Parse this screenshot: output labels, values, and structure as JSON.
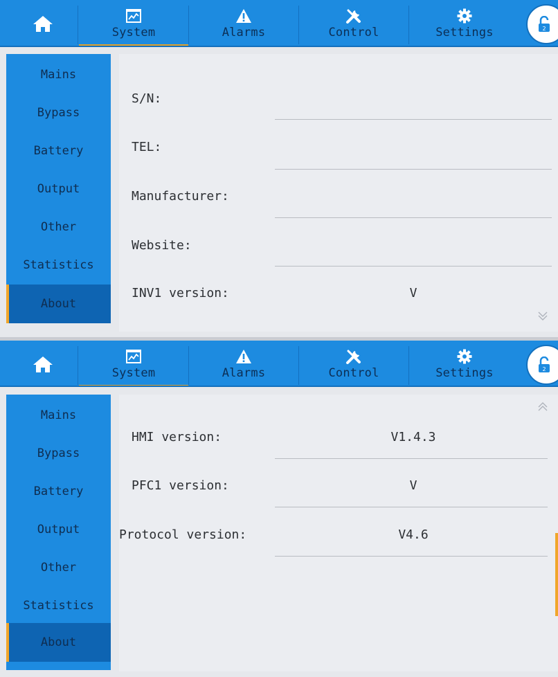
{
  "header": {
    "tabs": [
      {
        "label": "System",
        "icon": "chart-icon",
        "active": true
      },
      {
        "label": "Alarms",
        "icon": "warning-icon",
        "active": false
      },
      {
        "label": "Control",
        "icon": "tools-icon",
        "active": false
      },
      {
        "label": "Settings",
        "icon": "gear-icon",
        "active": false
      }
    ],
    "home_icon": "home-icon",
    "lock_icon": "unlock-icon",
    "lock_level": "2"
  },
  "sidebar": {
    "items": [
      {
        "label": "Mains"
      },
      {
        "label": "Bypass"
      },
      {
        "label": "Battery"
      },
      {
        "label": "Output"
      },
      {
        "label": "Other"
      },
      {
        "label": "Statistics"
      },
      {
        "label": "About",
        "active": true
      }
    ]
  },
  "about_page1": {
    "rows": [
      {
        "label": "S/N:",
        "value": ""
      },
      {
        "label": "TEL:",
        "value": ""
      },
      {
        "label": "Manufacturer:",
        "value": ""
      },
      {
        "label": "Website:",
        "value": ""
      },
      {
        "label": "INV1 version:",
        "value": "V"
      }
    ]
  },
  "about_page2": {
    "rows": [
      {
        "label": "HMI version:",
        "value": "V1.4.3"
      },
      {
        "label": "PFC1 version:",
        "value": "V"
      },
      {
        "label": "Protocol version:",
        "value": "V4.6"
      }
    ]
  },
  "colors": {
    "bar_blue": "#1d8be0",
    "active_blue": "#0e64b2",
    "accent_orange": "#f0a62a",
    "content_bg": "#ebedf1"
  }
}
